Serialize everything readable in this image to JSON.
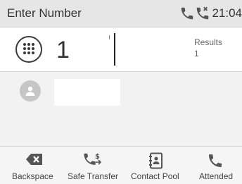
{
  "status_bar": {
    "title": "Enter Number",
    "icons": [
      "phone-icon",
      "missed-call-icon"
    ],
    "time": "21:04"
  },
  "input": {
    "number": "1",
    "results_label": "Results",
    "results_count": "1"
  },
  "results": [
    {
      "icon": "contact-avatar-icon",
      "name": ""
    }
  ],
  "softkeys": [
    {
      "label": "Backspace",
      "icon": "backspace-icon"
    },
    {
      "label": "Safe Transfer",
      "icon": "safe-transfer-icon"
    },
    {
      "label": "Contact Pool",
      "icon": "contact-pool-icon"
    },
    {
      "label": "Attended",
      "icon": "phone-icon"
    }
  ]
}
